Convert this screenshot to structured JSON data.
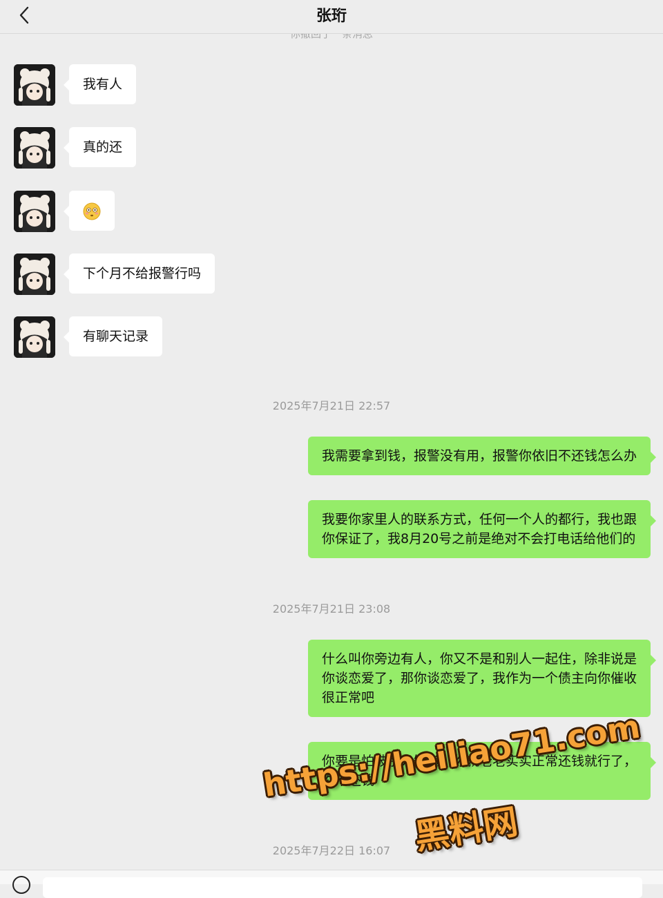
{
  "header": {
    "title": "张珩",
    "back_icon": "chevron-left-icon"
  },
  "system_notice_partial": "你撤回了一条消息",
  "left_messages": [
    {
      "text": "我有人"
    },
    {
      "text": "真的还"
    },
    {
      "text": "😳",
      "type": "emoji"
    },
    {
      "text": "下个月不给报警行吗"
    },
    {
      "text": "有聊天记录"
    }
  ],
  "timestamps": [
    "2025年7月21日 22:57",
    "2025年7月21日 23:08",
    "2025年7月22日 16:07"
  ],
  "right_messages": [
    {
      "text": "我需要拿到钱，报警没有用，报警你依旧不还钱怎么办"
    },
    {
      "lines": [
        "我要你家里人的联系方式，任何一个人的都行，我也跟",
        "你保证了，我8月20号之前是绝对不会打电话给他们的"
      ]
    },
    {
      "lines": [
        "什么叫你旁边有人，你又不是和别人一起住，除非说是",
        "你谈恋爱了，那你谈恋爱了，我作为一个债主向你催收",
        "很正常吧"
      ]
    },
    {
      "lines": [
        "你要是怕被别人知道，你就老老实实正常还钱就行了，",
        "你不还钱"
      ]
    }
  ],
  "watermark": {
    "url": "https://heiliao71.com",
    "name": "黑料网",
    "color": "#f6a238"
  },
  "colors": {
    "background": "#ededed",
    "sent_bubble": "#95ec69",
    "received_bubble": "#ffffff"
  }
}
